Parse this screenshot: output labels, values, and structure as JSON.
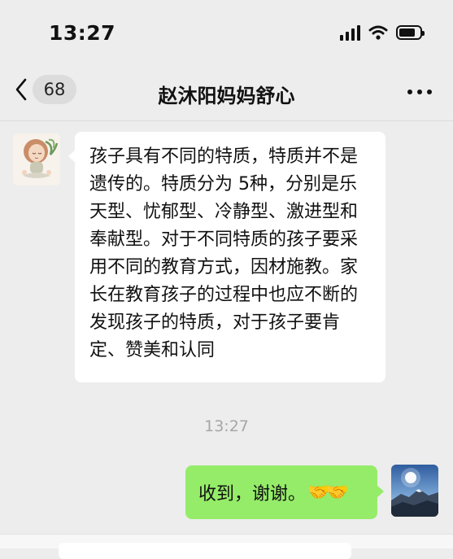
{
  "status_bar": {
    "time": "13:27",
    "battery_level": 0.8
  },
  "nav": {
    "back_count": "68",
    "title": "赵沐阳妈妈舒心"
  },
  "messages": [
    {
      "side": "left",
      "text": "孩子具有不同的特质，特质并不是遗传的。特质分为 5种，分别是乐天型、忧郁型、冷静型、激进型和奉献型。对于不同特质的孩子要采用不同的教育方式，因材施教。家长在教育孩子的过程中也应不断的发现孩子的特质，对于孩子要肯定、赞美和认同"
    },
    {
      "timestamp": "13:27"
    },
    {
      "side": "right",
      "text": "收到，谢谢。",
      "emoji": "🤝🤝"
    }
  ],
  "colors": {
    "background": "#ededed",
    "sent_bubble": "#95ec69",
    "received_bubble": "#ffffff"
  },
  "icons": {
    "signal": "cellular-signal-icon",
    "wifi": "wifi-icon",
    "battery": "battery-icon",
    "back": "chevron-left-icon",
    "more": "more-dots-icon"
  }
}
